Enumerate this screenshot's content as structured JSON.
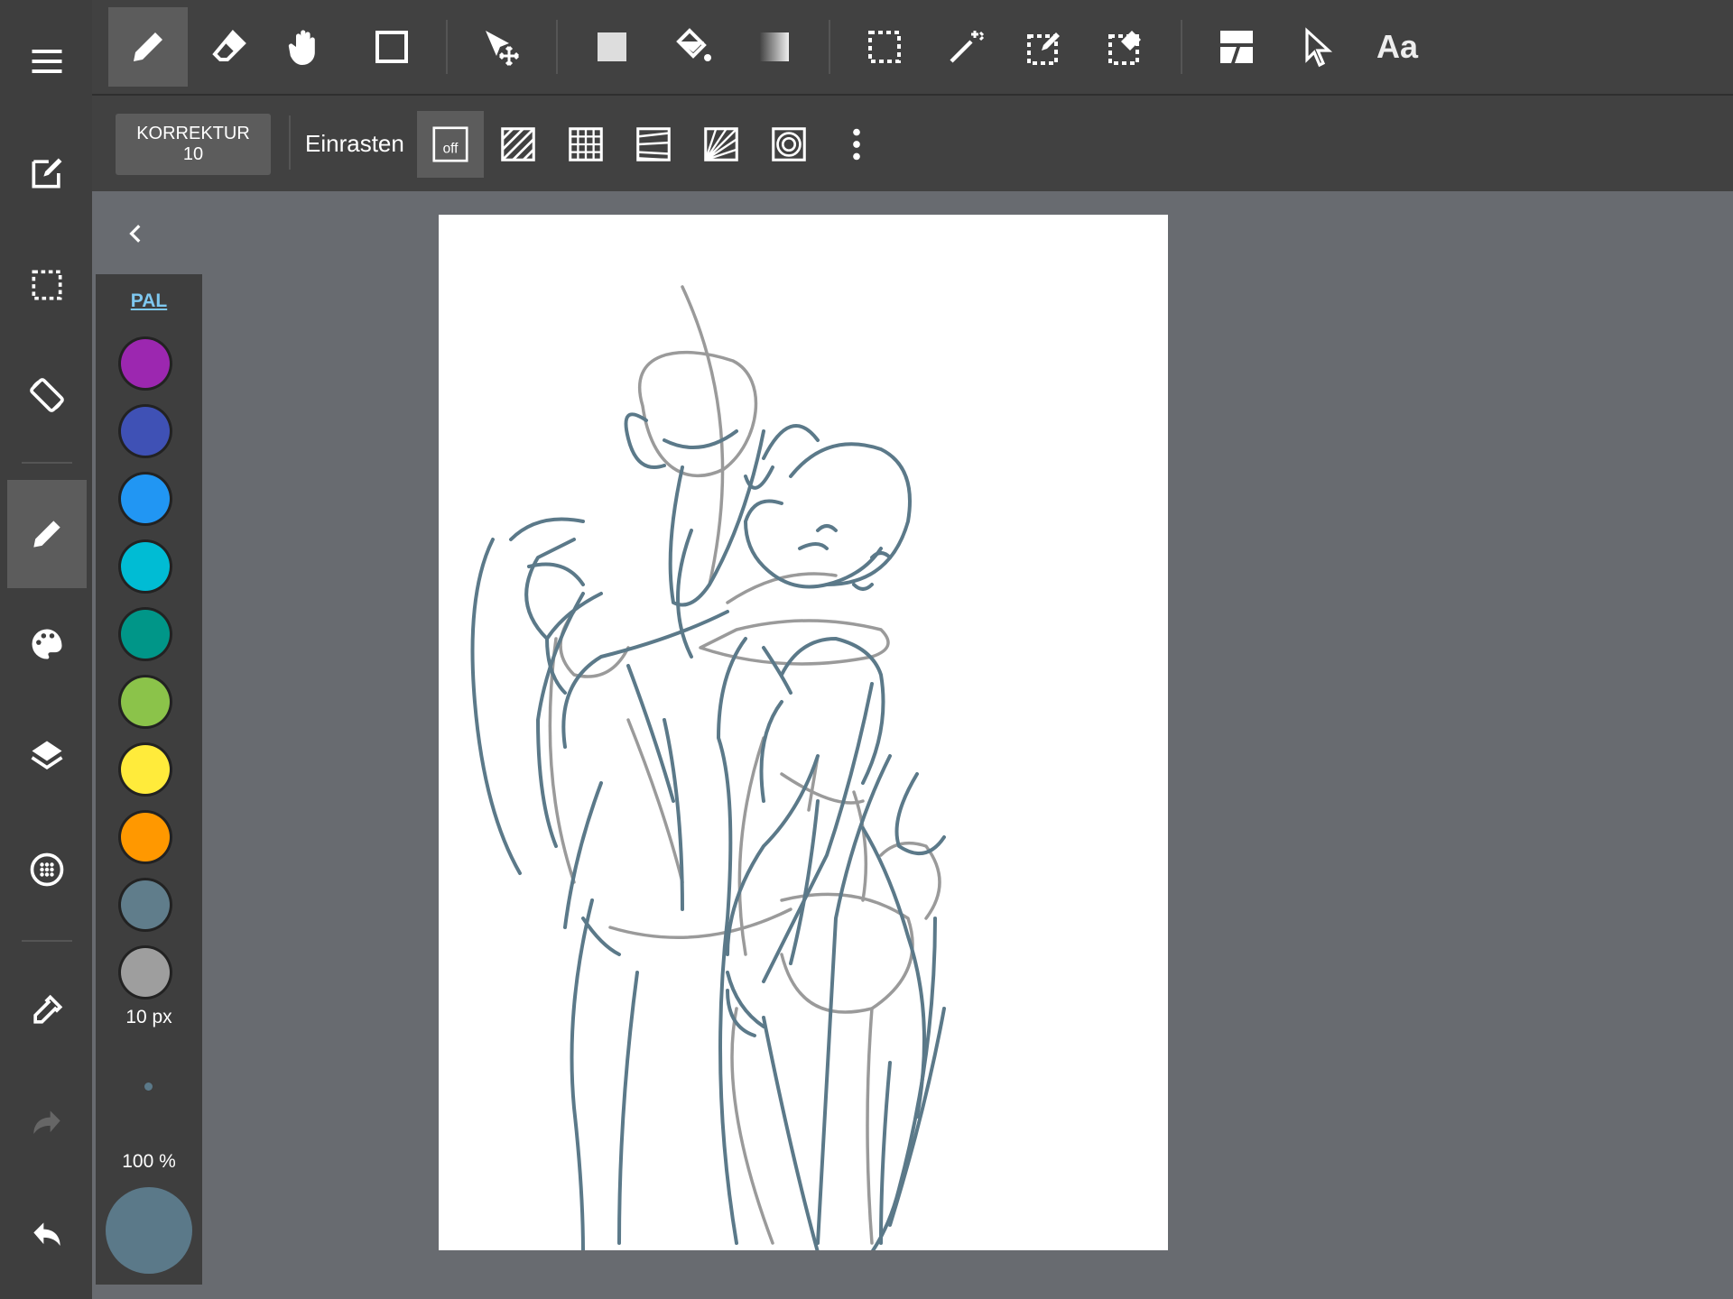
{
  "sub_toolbar": {
    "correction_label": "KORREKTUR",
    "correction_value": "10",
    "snap_label": "Einrasten",
    "snap_off_label": "off"
  },
  "top_toolbar": {
    "text_tool_label": "Aa"
  },
  "palette": {
    "label": "PAL",
    "colors": [
      "#9c27b0",
      "#3f51b5",
      "#2196f3",
      "#00bcd4",
      "#009688",
      "#8bc34a",
      "#ffeb3b",
      "#ff9800",
      "#607d8b",
      "#9e9e9e"
    ],
    "current_color": "#5b7989",
    "brush_size": "10 px",
    "opacity": "100 %"
  }
}
